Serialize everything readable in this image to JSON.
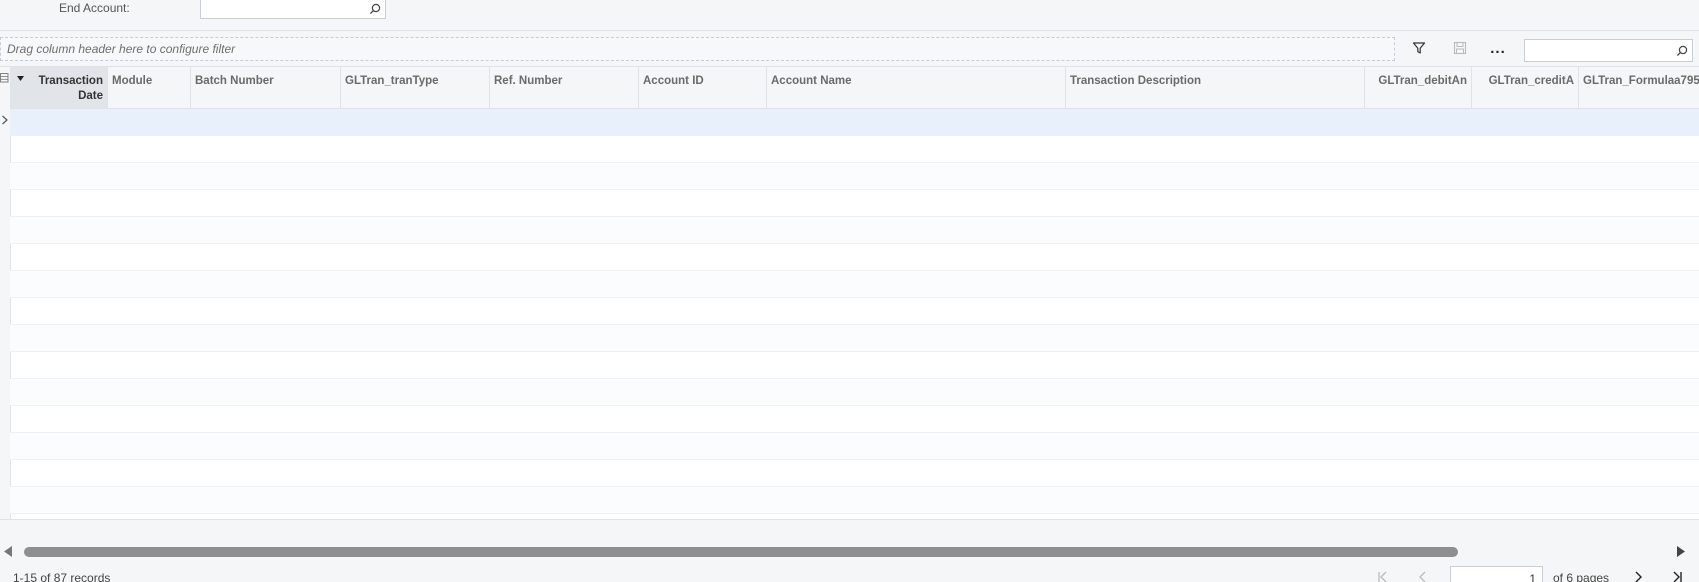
{
  "filter": {
    "end_account_label": "End Account:",
    "end_account_value": ""
  },
  "toolbar": {
    "drop_hint": "Drag column header here to configure filter",
    "more_label": "...",
    "search_value": ""
  },
  "grid": {
    "columns": [
      "Transaction Date",
      "Module",
      "Batch Number",
      "GLTran_tranType",
      "Ref. Number",
      "Account ID",
      "Account Name",
      "Transaction Description",
      "GLTran_debitAn",
      "GLTran_creditA",
      "GLTran_Formulaa795"
    ],
    "sorted_column": "Transaction Date",
    "row_count_visible": 15
  },
  "pager": {
    "records": "1-15 of 87 records",
    "page_value": "1",
    "of_pages": "of 6 pages"
  },
  "colors": {
    "accent": "#e8f1fb",
    "header_bg": "#f5f6f8",
    "sorted_header_bg": "#e1e5ea"
  },
  "icons": [
    "search-icon",
    "filter-icon",
    "save-icon",
    "grid-config-icon",
    "sort-desc-icon",
    "row-selector-icon",
    "first-page-icon",
    "prev-page-icon",
    "next-page-icon",
    "last-page-icon"
  ]
}
